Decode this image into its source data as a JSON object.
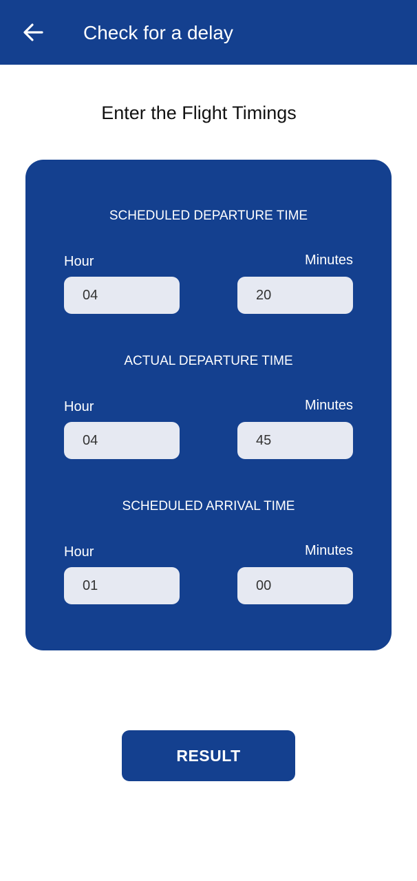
{
  "appbar": {
    "title": "Check for a delay",
    "back_icon": "arrow-left-icon"
  },
  "heading": "Enter the Flight Timings",
  "sections": [
    {
      "title": "SCHEDULED DEPARTURE TIME",
      "hour_label": "Hour",
      "minutes_label": "Minutes",
      "hour_value": "04",
      "minutes_value": "20"
    },
    {
      "title": "ACTUAL DEPARTURE TIME",
      "hour_label": "Hour",
      "minutes_label": "Minutes",
      "hour_value": "04",
      "minutes_value": "45"
    },
    {
      "title": "SCHEDULED ARRIVAL TIME",
      "hour_label": "Hour",
      "minutes_label": "Minutes",
      "hour_value": "01",
      "minutes_value": "00"
    }
  ],
  "result_button": "RESULT",
  "colors": {
    "primary": "#14408f",
    "field_bg": "#e6e9f2",
    "text_on_primary": "#ffffff"
  }
}
